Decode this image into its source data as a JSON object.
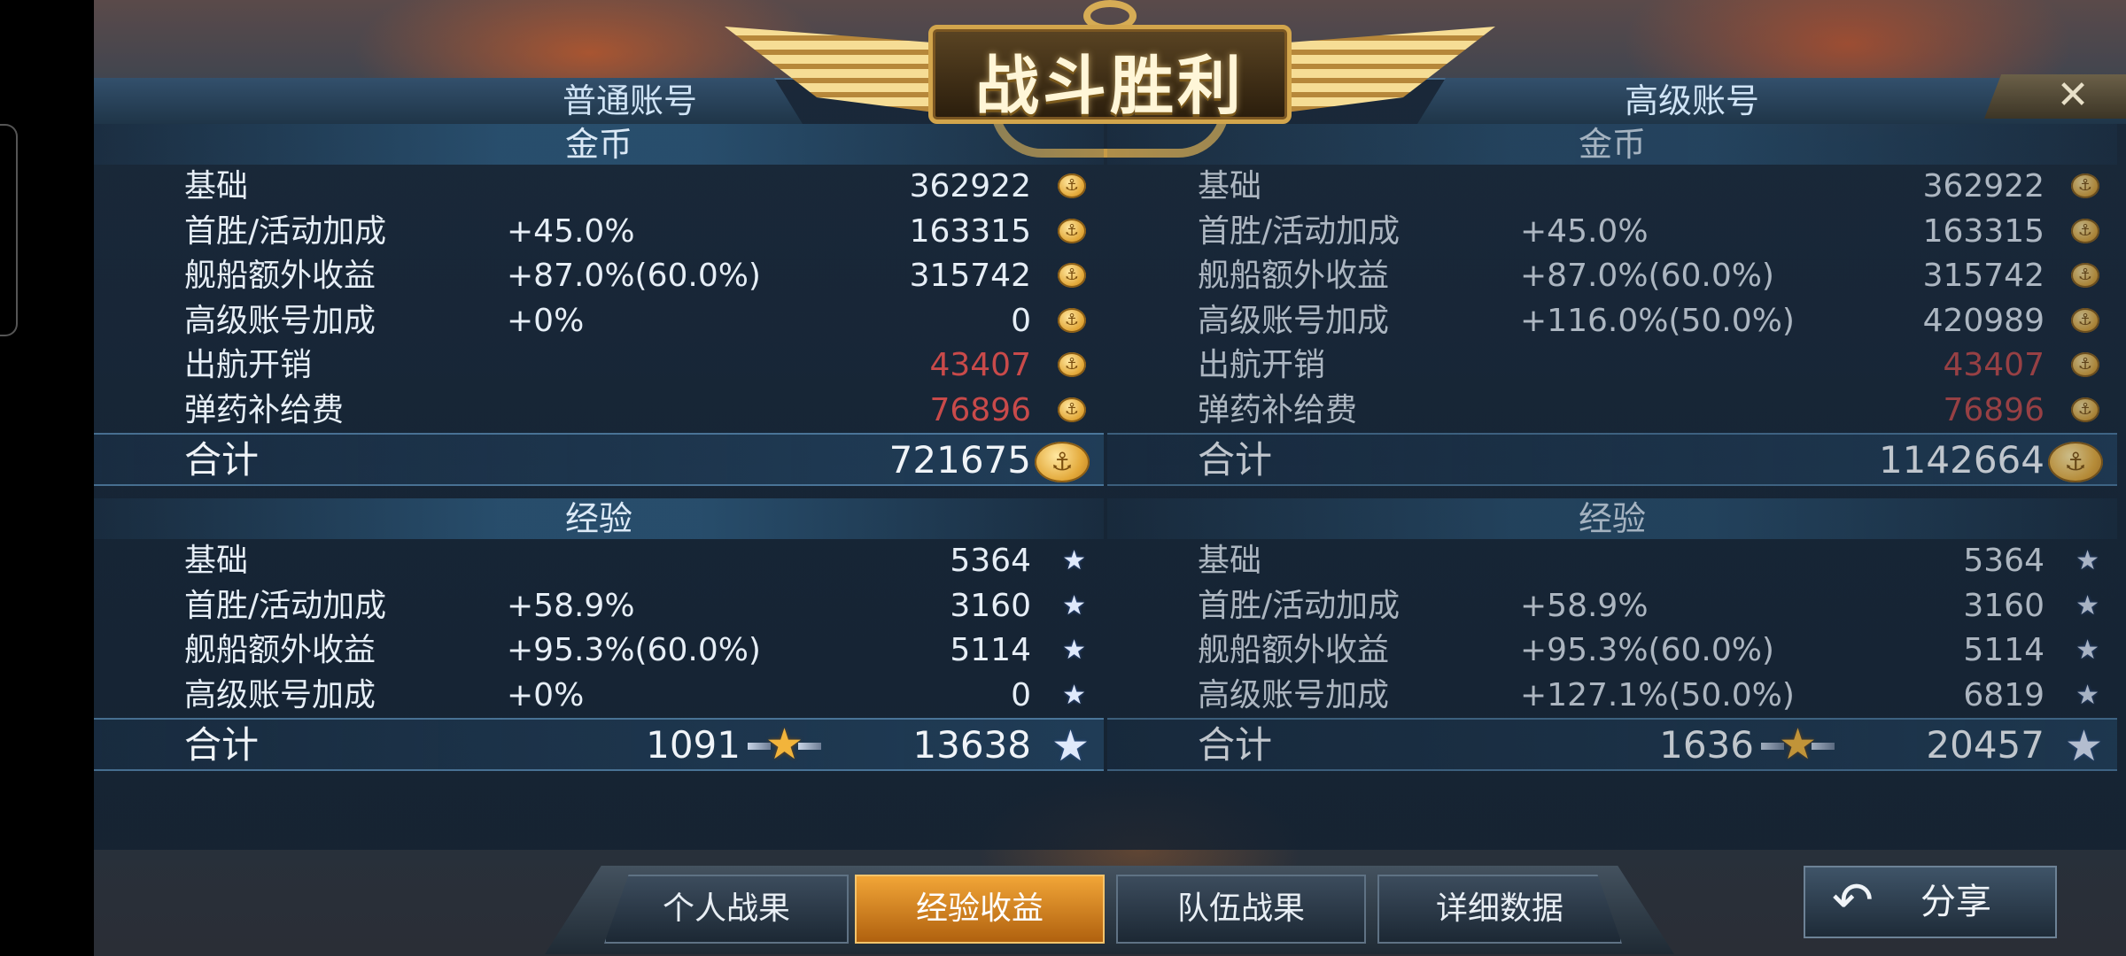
{
  "title": "战斗胜利",
  "close_symbol": "✕",
  "normal_account": {
    "header": "普通账号",
    "gold": {
      "section_title": "金币",
      "rows": [
        {
          "label": "基础",
          "pct": "",
          "value": "362922",
          "negative": false
        },
        {
          "label": "首胜/活动加成",
          "pct": "+45.0%",
          "value": "163315",
          "negative": false
        },
        {
          "label": "舰船额外收益",
          "pct": "+87.0%(60.0%)",
          "value": "315742",
          "negative": false
        },
        {
          "label": "高级账号加成",
          "pct": "+0%",
          "value": "0",
          "negative": false
        },
        {
          "label": "出航开销",
          "pct": "",
          "value": "43407",
          "negative": true
        },
        {
          "label": "弹药补给费",
          "pct": "",
          "value": "76896",
          "negative": true
        }
      ],
      "total_label": "合计",
      "total_value": "721675"
    },
    "exp": {
      "section_title": "经验",
      "rows": [
        {
          "label": "基础",
          "pct": "",
          "value": "5364"
        },
        {
          "label": "首胜/活动加成",
          "pct": "+58.9%",
          "value": "3160"
        },
        {
          "label": "舰船额外收益",
          "pct": "+95.3%(60.0%)",
          "value": "5114"
        },
        {
          "label": "高级账号加成",
          "pct": "+0%",
          "value": "0"
        }
      ],
      "total_label": "合计",
      "total_medal_value": "1091",
      "total_value": "13638"
    }
  },
  "premium_account": {
    "header": "高级账号",
    "gold": {
      "section_title": "金币",
      "rows": [
        {
          "label": "基础",
          "pct": "",
          "value": "362922",
          "negative": false
        },
        {
          "label": "首胜/活动加成",
          "pct": "+45.0%",
          "value": "163315",
          "negative": false
        },
        {
          "label": "舰船额外收益",
          "pct": "+87.0%(60.0%)",
          "value": "315742",
          "negative": false
        },
        {
          "label": "高级账号加成",
          "pct": "+116.0%(50.0%)",
          "value": "420989",
          "negative": false
        },
        {
          "label": "出航开销",
          "pct": "",
          "value": "43407",
          "negative": true
        },
        {
          "label": "弹药补给费",
          "pct": "",
          "value": "76896",
          "negative": true
        }
      ],
      "total_label": "合计",
      "total_value": "1142664"
    },
    "exp": {
      "section_title": "经验",
      "rows": [
        {
          "label": "基础",
          "pct": "",
          "value": "5364"
        },
        {
          "label": "首胜/活动加成",
          "pct": "+58.9%",
          "value": "3160"
        },
        {
          "label": "舰船额外收益",
          "pct": "+95.3%(60.0%)",
          "value": "5114"
        },
        {
          "label": "高级账号加成",
          "pct": "+127.1%(50.0%)",
          "value": "6819"
        }
      ],
      "total_label": "合计",
      "total_medal_value": "1636",
      "total_value": "20457"
    }
  },
  "nav": {
    "tabs": [
      "个人战果",
      "经验收益",
      "队伍战果",
      "详细数据"
    ],
    "active": "经验收益"
  },
  "share": {
    "label": "分享",
    "icon": "back-arrow-icon"
  },
  "icons": {
    "coin": "anchor-coin-icon",
    "star": "star-icon",
    "medal": "winged-star-medal-icon"
  },
  "colors": {
    "negative": "#c94a4a",
    "active_tab": "#e08a25",
    "emblem_gold": "#d2a54c"
  }
}
